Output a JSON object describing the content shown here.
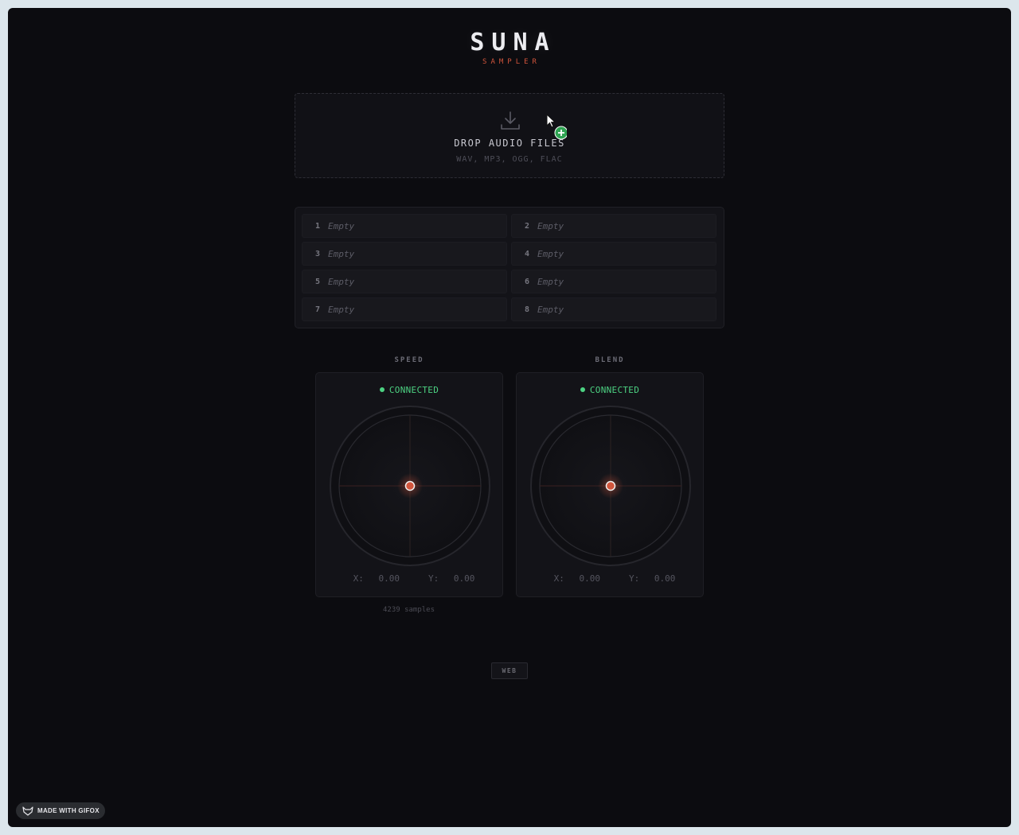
{
  "app": {
    "title": "SUNA",
    "subtitle": "SAMPLER"
  },
  "dropzone": {
    "title": "DROP AUDIO FILES",
    "formats": "WAV, MP3, OGG, FLAC",
    "icon": "download-icon"
  },
  "slots": [
    {
      "num": "1",
      "label": "Empty"
    },
    {
      "num": "2",
      "label": "Empty"
    },
    {
      "num": "3",
      "label": "Empty"
    },
    {
      "num": "4",
      "label": "Empty"
    },
    {
      "num": "5",
      "label": "Empty"
    },
    {
      "num": "6",
      "label": "Empty"
    },
    {
      "num": "7",
      "label": "Empty"
    },
    {
      "num": "8",
      "label": "Empty"
    }
  ],
  "pads": [
    {
      "title": "SPEED",
      "status": "CONNECTED",
      "x_label": "X:",
      "x": "0.00",
      "y_label": "Y:",
      "y": "0.00"
    },
    {
      "title": "BLEND",
      "status": "CONNECTED",
      "x_label": "X:",
      "x": "0.00",
      "y_label": "Y:",
      "y": "0.00"
    }
  ],
  "samples_text": "4239 samples",
  "web_button": "WEB",
  "gifox_badge": "MADE WITH GIFOX",
  "colors": {
    "accent": "#d2553c",
    "connected": "#4cd282",
    "background": "#0c0c10"
  }
}
